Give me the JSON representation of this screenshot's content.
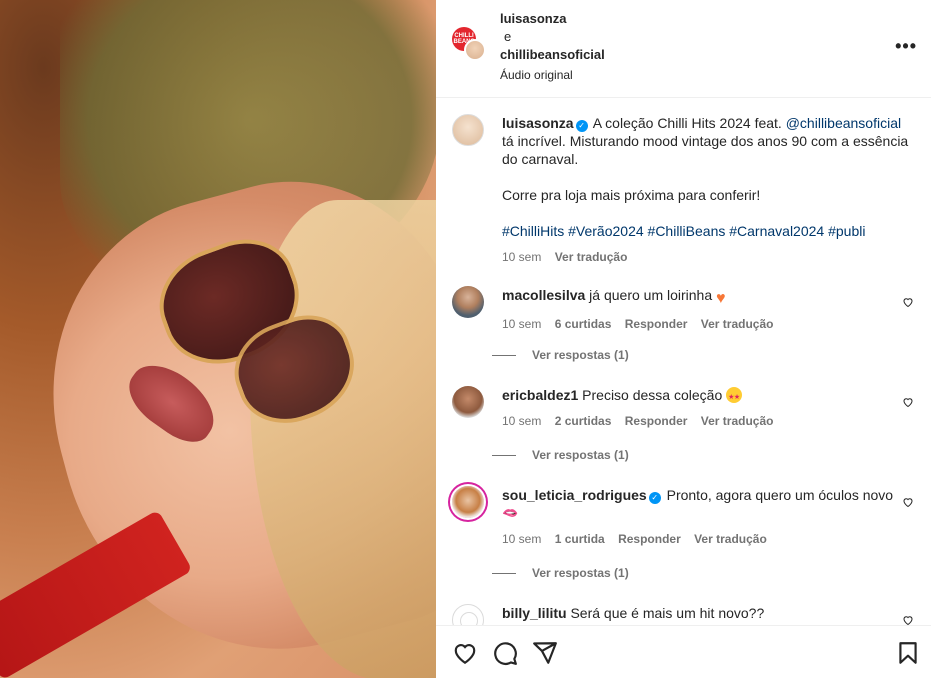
{
  "header": {
    "brand_badge": "CHILLI BEANS",
    "user1": "luisasonza",
    "joiner": "e",
    "user2": "chillibeansoficial",
    "audio": "Áudio original",
    "more": "•••"
  },
  "caption": {
    "username": "luisasonza",
    "text_before": "A coleção Chilli Hits 2024 feat.",
    "mention": "@chillibeansoficial",
    "text_after": "tá incrível. Misturando mood vintage dos anos 90 com a essência do carnaval.",
    "text2": "Corre pra loja mais próxima para conferir!",
    "hashtags": "#ChilliHits #Verão2024 #ChilliBeans #Carnaval2024 #publi",
    "time": "10 sem",
    "translate": "Ver tradução"
  },
  "comments": [
    {
      "username": "macollesilva",
      "text": "já quero um loirinha",
      "time": "10 sem",
      "likes": "6 curtidas",
      "reply": "Responder",
      "translate": "Ver tradução",
      "replies": "Ver respostas (1)"
    },
    {
      "username": "ericbaldez1",
      "text": "Preciso dessa coleção",
      "time": "10 sem",
      "likes": "2 curtidas",
      "reply": "Responder",
      "translate": "Ver tradução",
      "replies": "Ver respostas (1)"
    },
    {
      "username": "sou_leticia_rodrigues",
      "text": "Pronto, agora quero um óculos novo",
      "extra": "🫦",
      "time": "10 sem",
      "likes": "1 curtida",
      "reply": "Responder",
      "translate": "Ver tradução",
      "replies": "Ver respostas (1)"
    },
    {
      "username": "billy_lilitu",
      "text": "Será que é mais um hit novo??"
    }
  ],
  "icons": {
    "like": "heart-icon",
    "comment": "comment-icon",
    "share": "share-icon",
    "save": "bookmark-icon"
  }
}
